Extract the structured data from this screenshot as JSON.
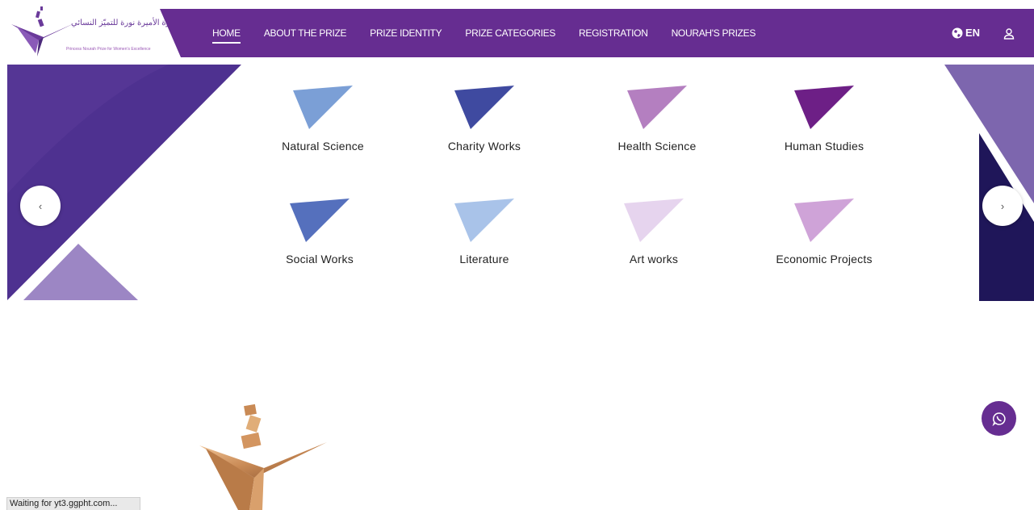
{
  "logo": {
    "arabic_text": "جائزة الأميرة نورة للتميّز النسائي",
    "english_text": "Princess Nourah Prize for Women's Excellence"
  },
  "nav": {
    "items": [
      {
        "label": "HOME",
        "active": true
      },
      {
        "label": "ABOUT THE PRIZE"
      },
      {
        "label": "PRIZE IDENTITY"
      },
      {
        "label": "PRIZE CATEGORIES"
      },
      {
        "label": "REGISTRATION"
      },
      {
        "label": "NOURAH'S PRIZES"
      }
    ],
    "language_label": "EN",
    "icons": {
      "language": "globe-icon",
      "user": "user-icon"
    }
  },
  "categories": [
    {
      "label": "Natural Science",
      "color": "#7b9fd6"
    },
    {
      "label": "Charity Works",
      "color": "#3f4aa0"
    },
    {
      "label": "Health Science",
      "color": "#b47fc0"
    },
    {
      "label": "Human Studies",
      "color": "#6d1f86"
    },
    {
      "label": "Social Works",
      "color": "#5570bd"
    },
    {
      "label": "Literature",
      "color": "#a9c3e9"
    },
    {
      "label": "Art works",
      "color": "#e6d4ee"
    },
    {
      "label": "Economic Projects",
      "color": "#cfa3d8"
    }
  ],
  "carousel": {
    "prev_icon": "chevron-left-icon",
    "next_icon": "chevron-right-icon",
    "prev_glyph": "‹",
    "next_glyph": "›"
  },
  "theme": {
    "primary": "#662d91",
    "accent_dark": "#1f1659",
    "accent_light": "#9c86c4"
  },
  "status_bar": {
    "text": "Waiting for yt3.ggpht.com..."
  }
}
